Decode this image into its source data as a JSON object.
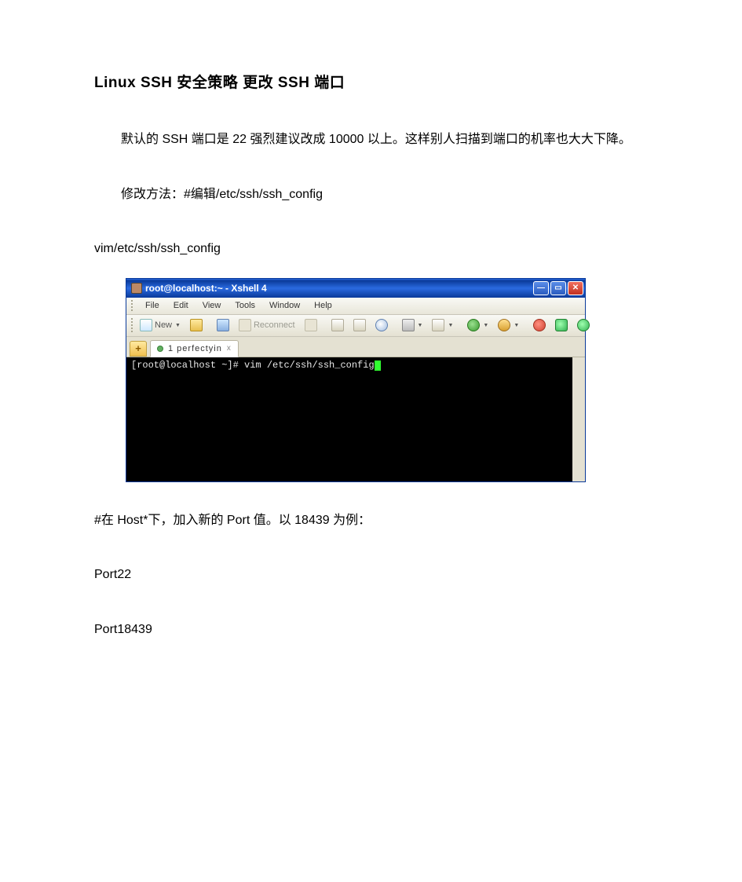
{
  "title": "Linux SSH 安全策略 更改 SSH 端口",
  "para1": "默认的 SSH 端口是 22 强烈建议改成 10000 以上。这样别人扫描到端口的机率也大大下降。",
  "para2": "修改方法：#编辑/etc/ssh/ssh_config",
  "para3": "vim/etc/ssh/ssh_config",
  "para4": "#在 Host*下，加入新的 Port 值。以 18439 为例：",
  "para5": "Port22",
  "para6": "Port18439",
  "xshell": {
    "titlebar": "root@localhost:~ - Xshell 4",
    "menu": {
      "file": "File",
      "edit": "Edit",
      "view": "View",
      "tools": "Tools",
      "window": "Window",
      "help": "Help"
    },
    "toolbar": {
      "new": "New",
      "reconnect": "Reconnect"
    },
    "tab": {
      "label": "1 perfectyin",
      "close": "x"
    },
    "addtab": "+",
    "term_prefix": "[root@localhost ~]# ",
    "term_cmd": "vim /etc/ssh/ssh_config"
  }
}
